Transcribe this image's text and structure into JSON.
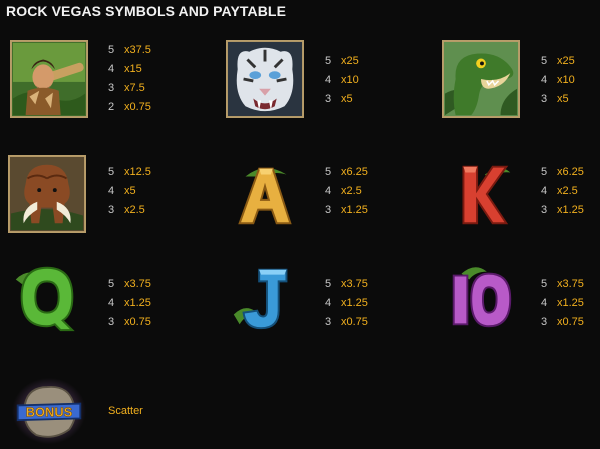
{
  "title": "ROCK VEGAS SYMBOLS AND PAYTABLE",
  "colors": {
    "background": "#0b0b0b",
    "count": "#c8c8c8",
    "payout": "#f2b01e"
  },
  "symbols": [
    {
      "icon": "caveman-icon",
      "pays": [
        [
          "5",
          "x37.5"
        ],
        [
          "4",
          "x15"
        ],
        [
          "3",
          "x7.5"
        ],
        [
          "2",
          "x0.75"
        ]
      ]
    },
    {
      "icon": "white-tiger-icon",
      "pays": [
        [
          "5",
          "x25"
        ],
        [
          "4",
          "x10"
        ],
        [
          "3",
          "x5"
        ]
      ]
    },
    {
      "icon": "dinosaur-icon",
      "pays": [
        [
          "5",
          "x25"
        ],
        [
          "4",
          "x10"
        ],
        [
          "3",
          "x5"
        ]
      ]
    },
    {
      "icon": "mammoth-icon",
      "pays": [
        [
          "5",
          "x12.5"
        ],
        [
          "4",
          "x5"
        ],
        [
          "3",
          "x2.5"
        ]
      ]
    },
    {
      "icon": "letter-a-icon",
      "pays": [
        [
          "5",
          "x6.25"
        ],
        [
          "4",
          "x2.5"
        ],
        [
          "3",
          "x1.25"
        ]
      ]
    },
    {
      "icon": "letter-k-icon",
      "pays": [
        [
          "5",
          "x6.25"
        ],
        [
          "4",
          "x2.5"
        ],
        [
          "3",
          "x1.25"
        ]
      ]
    },
    {
      "icon": "letter-q-icon",
      "pays": [
        [
          "5",
          "x3.75"
        ],
        [
          "4",
          "x1.25"
        ],
        [
          "3",
          "x0.75"
        ]
      ]
    },
    {
      "icon": "letter-j-icon",
      "pays": [
        [
          "5",
          "x3.75"
        ],
        [
          "4",
          "x1.25"
        ],
        [
          "3",
          "x0.75"
        ]
      ]
    },
    {
      "icon": "number-10-icon",
      "pays": [
        [
          "5",
          "x3.75"
        ],
        [
          "4",
          "x1.25"
        ],
        [
          "3",
          "x0.75"
        ]
      ]
    }
  ],
  "bonus": {
    "icon": "bonus-scatter-icon",
    "badge_text": "BONUS",
    "label": "Scatter"
  }
}
